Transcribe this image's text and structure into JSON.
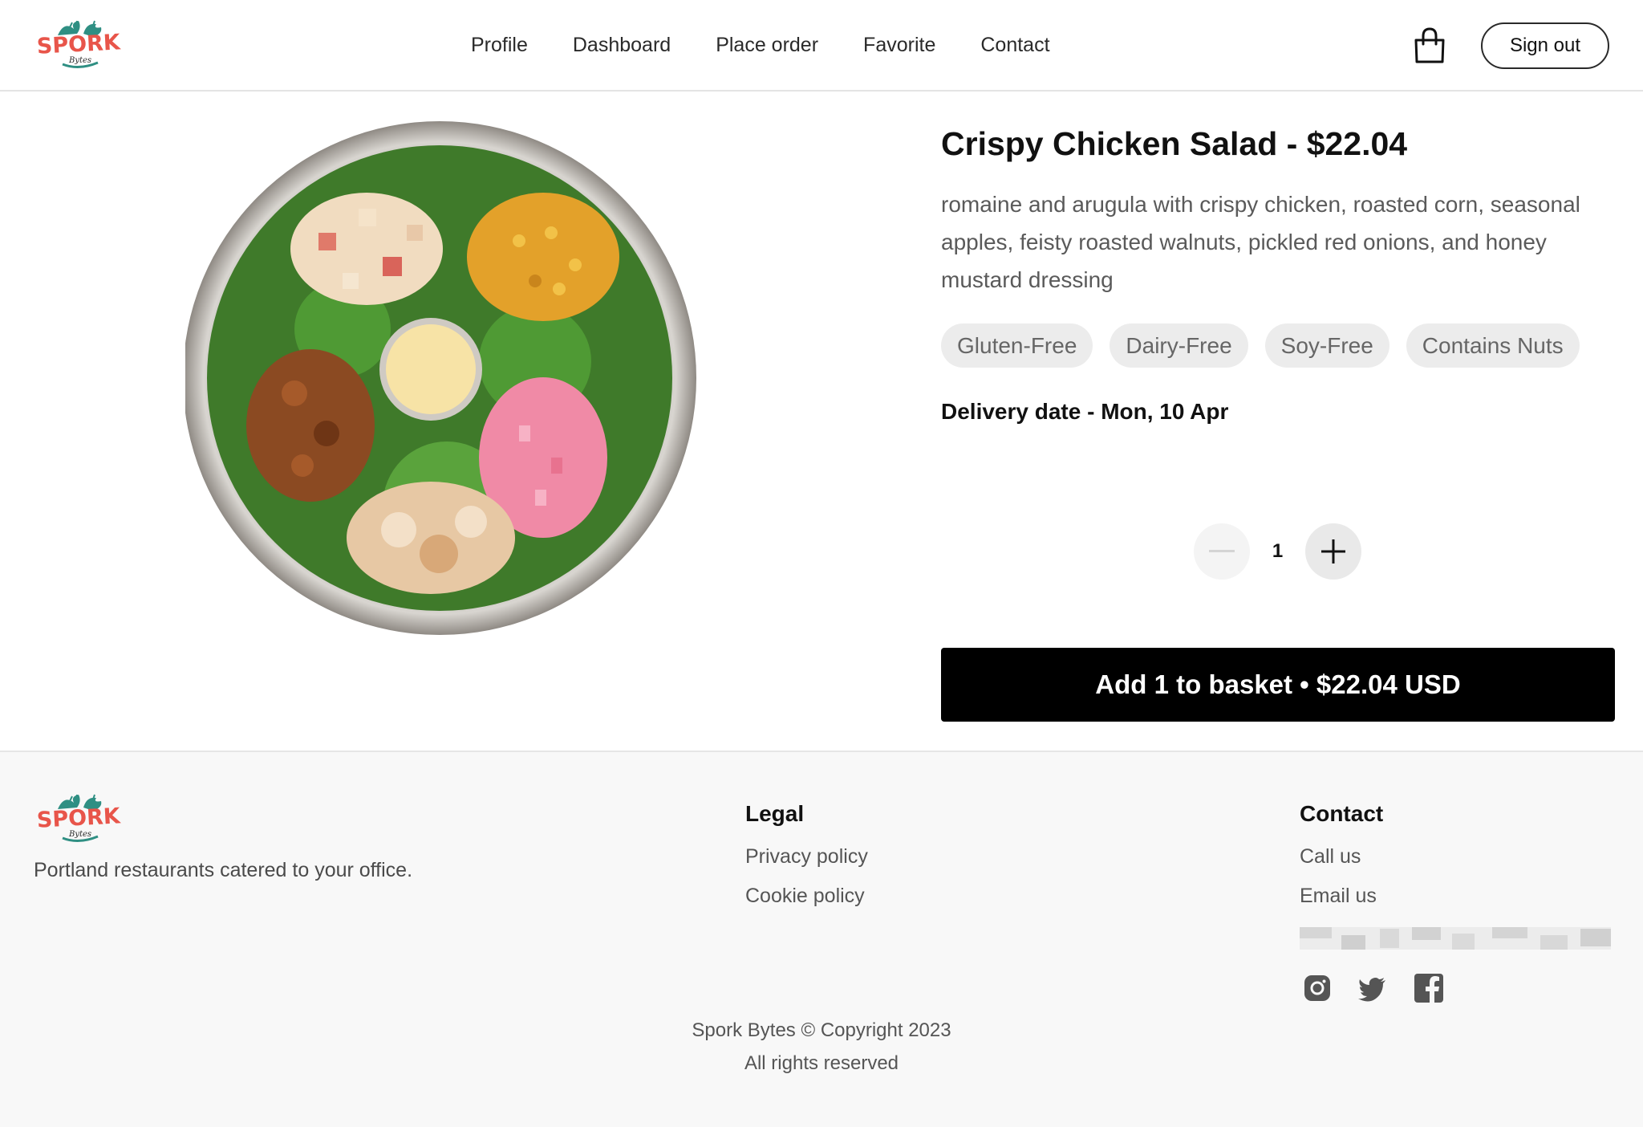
{
  "brand": {
    "logo_text": "SPORK",
    "logo_script": "Bytes",
    "logo_colors": {
      "primary": "#e8554a",
      "leaf": "#2f8f83"
    }
  },
  "nav": {
    "items": [
      {
        "label": "Profile"
      },
      {
        "label": "Dashboard"
      },
      {
        "label": "Place order"
      },
      {
        "label": "Favorite"
      },
      {
        "label": "Contact"
      }
    ],
    "cart_icon": "shopping-bag-icon",
    "signout_label": "Sign out"
  },
  "product": {
    "title": "Crispy Chicken Salad - $22.04",
    "description": "romaine and arugula with crispy chicken, roasted corn, seasonal apples, feisty roasted walnuts, pickled red onions, and honey mustard dressing",
    "tags": [
      "Gluten-Free",
      "Dairy-Free",
      "Soy-Free",
      "Contains Nuts"
    ],
    "delivery": "Delivery date - Mon, 10 Apr",
    "quantity": "1",
    "add_button": "Add 1 to basket • $22.04 USD"
  },
  "footer": {
    "tagline": "Portland restaurants catered to your office.",
    "legal_title": "Legal",
    "privacy": "Privacy policy",
    "cookie": "Cookie policy",
    "contact_title": "Contact",
    "call": "Call us",
    "email": "Email us",
    "social_icons": [
      "instagram-icon",
      "twitter-icon",
      "facebook-icon"
    ],
    "copyright": "Spork Bytes © Copyright 2023",
    "rights": "All rights reserved"
  },
  "colors": {
    "accent": "#000000",
    "tag_bg": "#ececec",
    "footer_bg": "#f8f8f8"
  }
}
